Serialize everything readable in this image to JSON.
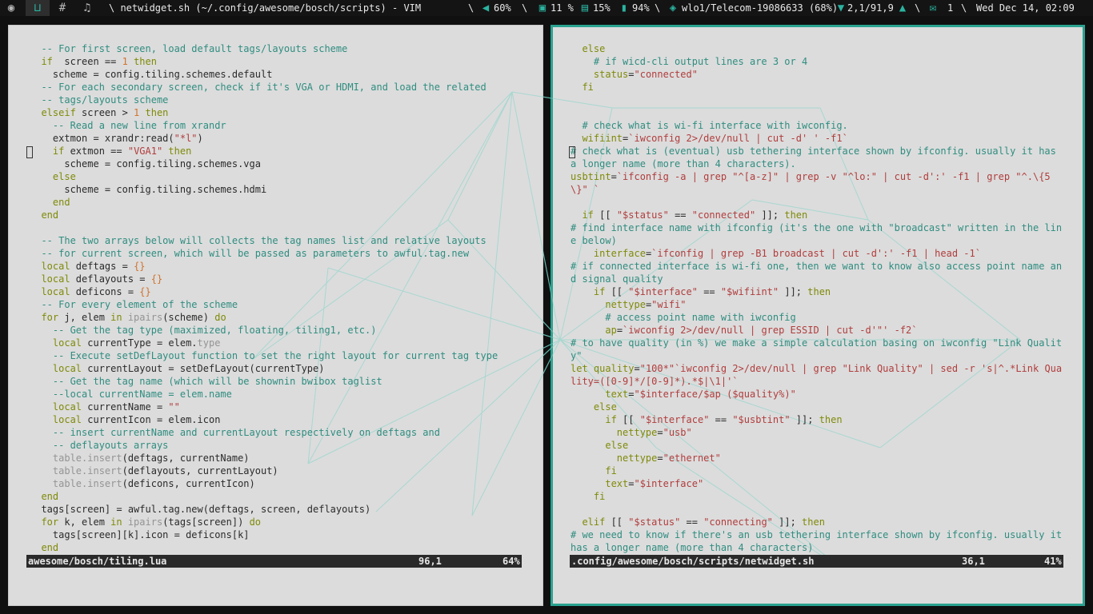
{
  "topbar": {
    "title": "\\  netwidget.sh (~/.config/awesome/bosch/scripts) - VIM",
    "volume": "60%",
    "sep1": "\\",
    "cpu": "11 %",
    "mem": "15%",
    "battery": "94%",
    "sep2": "\\",
    "net": "wlo1/Telecom-19086633 (68%)",
    "netspeed": "2,1/91,9",
    "sep3": "\\",
    "mail": "1",
    "sep4": "\\",
    "clock": "Wed Dec 14, 02:09",
    "icons": [
      "awesome-icon",
      "tag-dev-icon",
      "tag-hash-icon",
      "tag-music-icon",
      "volume-icon",
      "cpu-icon",
      "memory-icon",
      "battery-icon",
      "down-arrow-icon",
      "up-arrow-icon",
      "mail-icon"
    ],
    "accent": "#2bb3a0"
  },
  "left": {
    "status_file": "awesome/bosch/tiling.lua",
    "status_pos": "96,1",
    "status_pct": "64%",
    "lines": [
      [
        [
          "c",
          "  -- For first screen, load default tags/layouts scheme"
        ]
      ],
      [
        [
          "k",
          "  if"
        ],
        [
          "",
          "  screen == "
        ],
        [
          "n",
          "1"
        ],
        [
          "k",
          " then"
        ]
      ],
      [
        [
          "",
          "    scheme = config.tiling.schemes.default"
        ]
      ],
      [
        [
          "c",
          "  -- For each secondary screen, check if it's VGA or HDMI, and load the related"
        ]
      ],
      [
        [
          "c",
          "  -- tags/layouts scheme"
        ]
      ],
      [
        [
          "k",
          "  elseif"
        ],
        [
          "",
          " screen > "
        ],
        [
          "n",
          "1"
        ],
        [
          "k",
          " then"
        ]
      ],
      [
        [
          "c",
          "    -- Read a new line from xrandr"
        ]
      ],
      [
        [
          "",
          "    extmon = xrandr:read("
        ],
        [
          "s",
          "\"*l\""
        ],
        [
          "",
          ")"
        ]
      ],
      [
        [
          "k",
          "    if"
        ],
        [
          "",
          " extmon == "
        ],
        [
          "s",
          "\"VGA1\""
        ],
        [
          "k",
          " then"
        ]
      ],
      [
        [
          "",
          "      scheme = config.tiling.schemes.vga"
        ]
      ],
      [
        [
          "k",
          "    else"
        ]
      ],
      [
        [
          "",
          "      scheme = config.tiling.schemes.hdmi"
        ]
      ],
      [
        [
          "k",
          "    end"
        ]
      ],
      [
        [
          "k",
          "  end"
        ]
      ],
      [
        [
          "",
          ""
        ]
      ],
      [
        [
          "c",
          "  -- The two arrays below will collects the tag names list and relative layouts"
        ]
      ],
      [
        [
          "c",
          "  -- for current screen, which will be passed as parameters to awful.tag.new"
        ]
      ],
      [
        [
          "k",
          "  local"
        ],
        [
          "",
          " deftags = "
        ],
        [
          "n",
          "{}"
        ]
      ],
      [
        [
          "k",
          "  local"
        ],
        [
          "",
          " deflayouts = "
        ],
        [
          "n",
          "{}"
        ]
      ],
      [
        [
          "k",
          "  local"
        ],
        [
          "",
          " deficons = "
        ],
        [
          "n",
          "{}"
        ]
      ],
      [
        [
          "c",
          "  -- For every element of the scheme"
        ]
      ],
      [
        [
          "k",
          "  for"
        ],
        [
          "",
          " j, elem "
        ],
        [
          "k",
          "in"
        ],
        [
          "g",
          " ipairs"
        ],
        [
          "",
          "(scheme) "
        ],
        [
          "k",
          "do"
        ]
      ],
      [
        [
          "c",
          "    -- Get the tag type (maximized, floating, tiling1, etc.)"
        ]
      ],
      [
        [
          "k",
          "    local"
        ],
        [
          "",
          " currentType = elem."
        ],
        [
          "g",
          "type"
        ]
      ],
      [
        [
          "c",
          "    -- Execute setDefLayout function to set the right layout for current tag type"
        ]
      ],
      [
        [
          "k",
          "    local"
        ],
        [
          "",
          " currentLayout = setDefLayout(currentType)"
        ]
      ],
      [
        [
          "c",
          "    -- Get the tag name (which will be shownin bwibox taglist"
        ]
      ],
      [
        [
          "c",
          "    --local currentName = elem.name"
        ]
      ],
      [
        [
          "k",
          "    local"
        ],
        [
          "",
          " currentName = "
        ],
        [
          "s",
          "\"\""
        ]
      ],
      [
        [
          "k",
          "    local"
        ],
        [
          "",
          " currentIcon = elem.icon"
        ]
      ],
      [
        [
          "c",
          "    -- insert currentName and currentLayout respectively on deftags and"
        ]
      ],
      [
        [
          "c",
          "    -- deflayouts arrays"
        ]
      ],
      [
        [
          "g",
          "    table.insert"
        ],
        [
          "",
          "(deftags, currentName)"
        ]
      ],
      [
        [
          "g",
          "    table.insert"
        ],
        [
          "",
          "(deflayouts, currentLayout)"
        ]
      ],
      [
        [
          "g",
          "    table.insert"
        ],
        [
          "",
          "(deficons, currentIcon)"
        ]
      ],
      [
        [
          "k",
          "  end"
        ]
      ],
      [
        [
          "",
          "  tags[screen] = awful.tag.new(deftags, screen, deflayouts)"
        ]
      ],
      [
        [
          "k",
          "  for"
        ],
        [
          "",
          " k, elem "
        ],
        [
          "k",
          "in"
        ],
        [
          "g",
          " ipairs"
        ],
        [
          "",
          "(tags[screen]) "
        ],
        [
          "k",
          "do"
        ]
      ],
      [
        [
          "",
          "    tags[screen][k].icon = deficons[k]"
        ]
      ],
      [
        [
          "k",
          "  end"
        ]
      ]
    ]
  },
  "right": {
    "status_file": ".config/awesome/bosch/scripts/netwidget.sh",
    "status_pos": "36,1",
    "status_pct": "41%",
    "lines": [
      [
        [
          "k",
          "  else"
        ]
      ],
      [
        [
          "c",
          "    # if wicd-cli output lines are 3 or 4"
        ]
      ],
      [
        [
          "",
          "    "
        ],
        [
          "k",
          "status"
        ],
        [
          "",
          "="
        ],
        [
          "s",
          "\"connected\""
        ]
      ],
      [
        [
          "k",
          "  fi"
        ]
      ],
      [
        [
          "",
          ""
        ]
      ],
      [
        [
          "",
          ""
        ]
      ],
      [
        [
          "c",
          "  # check what is wi-fi interface with iwconfig."
        ]
      ],
      [
        [
          "",
          "  "
        ],
        [
          "k",
          "wifiint"
        ],
        [
          "",
          "="
        ],
        [
          "s",
          "`iwconfig 2>/dev/null | cut -d' ' -f1`"
        ]
      ],
      [
        [
          "c",
          "  # check what is (eventual) usb tethering interface shown by ifconfig. usually it has a longer name (more than 4 characters)."
        ]
      ],
      [
        [
          "",
          "  "
        ],
        [
          "k",
          "usbtint"
        ],
        [
          "",
          "="
        ],
        [
          "s",
          "`ifconfig -a | grep \"^[a-z]\" | grep -v \"^lo:\" | cut -d':' -f1 | grep \"^.\\{5\\}\" `"
        ]
      ],
      [
        [
          "",
          ""
        ]
      ],
      [
        [
          "",
          "  "
        ],
        [
          "k",
          "if"
        ],
        [
          "",
          " [[ "
        ],
        [
          "s",
          "\"$status\""
        ],
        [
          "",
          " == "
        ],
        [
          "s",
          "\"connected\""
        ],
        [
          "",
          " ]]; "
        ],
        [
          "k",
          "then"
        ]
      ],
      [
        [
          "c",
          "    # find interface name with ifconfig (it's the one with \"broadcast\" written in the line below)"
        ]
      ],
      [
        [
          "",
          "    "
        ],
        [
          "k",
          "interface"
        ],
        [
          "",
          "="
        ],
        [
          "s",
          "`ifconfig | grep -B1 broadcast | cut -d':' -f1 | head -1`"
        ]
      ],
      [
        [
          "c",
          "    # if connected interface is wi-fi one, then we want to know also access point name and signal quality"
        ]
      ],
      [
        [
          "",
          "    "
        ],
        [
          "k",
          "if"
        ],
        [
          "",
          " [[ "
        ],
        [
          "s",
          "\"$interface\""
        ],
        [
          "",
          " == "
        ],
        [
          "s",
          "\"$wifiint\""
        ],
        [
          "",
          " ]]; "
        ],
        [
          "k",
          "then"
        ]
      ],
      [
        [
          "",
          "      "
        ],
        [
          "k",
          "nettype"
        ],
        [
          "",
          "="
        ],
        [
          "s",
          "\"wifi\""
        ]
      ],
      [
        [
          "c",
          "      # access point name with iwconfig"
        ]
      ],
      [
        [
          "",
          "      "
        ],
        [
          "k",
          "ap"
        ],
        [
          "",
          "="
        ],
        [
          "s",
          "`iwconfig 2>/dev/null | grep ESSID | cut -d'\"' -f2`"
        ]
      ],
      [
        [
          "c",
          "      # to have quality (in %) we make a simple calculation basing on iwconfig \"Link Quality\""
        ]
      ],
      [
        [
          "",
          "      "
        ],
        [
          "k",
          "let"
        ],
        [
          "",
          " "
        ],
        [
          "k",
          "quality"
        ],
        [
          "",
          "="
        ],
        [
          "s",
          "\"100*\"`iwconfig 2>/dev/null | grep \"Link Quality\" | sed -r 's|^.*Link Quality=([0-9]*/[0-9]*).*$|\\1|'`"
        ]
      ],
      [
        [
          "",
          "      "
        ],
        [
          "k",
          "text"
        ],
        [
          "",
          "="
        ],
        [
          "s",
          "\"$interface/$ap ($quality%)\""
        ]
      ],
      [
        [
          "",
          "    "
        ],
        [
          "k",
          "else"
        ]
      ],
      [
        [
          "",
          "      "
        ],
        [
          "k",
          "if"
        ],
        [
          "",
          " [[ "
        ],
        [
          "s",
          "\"$interface\""
        ],
        [
          "",
          " == "
        ],
        [
          "s",
          "\"$usbtint\""
        ],
        [
          "",
          " ]]; "
        ],
        [
          "k",
          "then"
        ]
      ],
      [
        [
          "",
          "        "
        ],
        [
          "k",
          "nettype"
        ],
        [
          "",
          "="
        ],
        [
          "s",
          "\"usb\""
        ]
      ],
      [
        [
          "",
          "      "
        ],
        [
          "k",
          "else"
        ]
      ],
      [
        [
          "",
          "        "
        ],
        [
          "k",
          "nettype"
        ],
        [
          "",
          "="
        ],
        [
          "s",
          "\"ethernet\""
        ]
      ],
      [
        [
          "",
          "      "
        ],
        [
          "k",
          "fi"
        ]
      ],
      [
        [
          "",
          "      "
        ],
        [
          "k",
          "text"
        ],
        [
          "",
          "="
        ],
        [
          "s",
          "\"$interface\""
        ]
      ],
      [
        [
          "",
          "    "
        ],
        [
          "k",
          "fi"
        ]
      ],
      [
        [
          "",
          ""
        ]
      ],
      [
        [
          "",
          "  "
        ],
        [
          "k",
          "elif"
        ],
        [
          "",
          " [[ "
        ],
        [
          "s",
          "\"$status\""
        ],
        [
          "",
          " == "
        ],
        [
          "s",
          "\"connecting\""
        ],
        [
          "",
          " ]]; "
        ],
        [
          "k",
          "then"
        ]
      ],
      [
        [
          "c",
          "    # we need to know if there's an usb tethering interface shown by ifconfig. usually it has a longer name (more than 4 characters)"
        ]
      ]
    ]
  }
}
